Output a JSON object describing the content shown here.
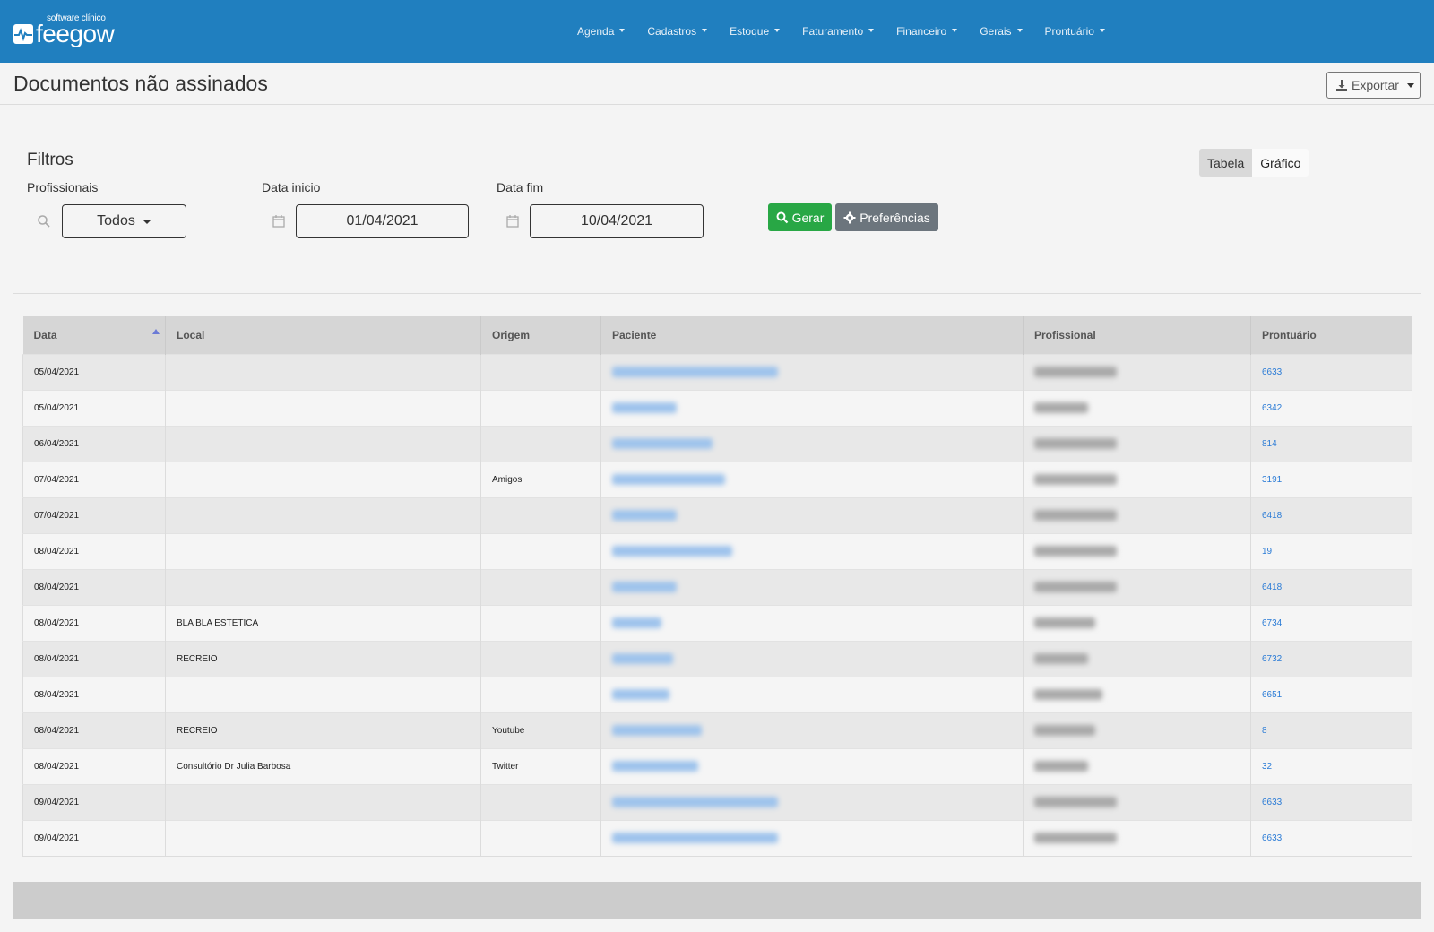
{
  "app": {
    "logo_sub": "software clínico",
    "logo_main": "feegow"
  },
  "nav": [
    {
      "label": "Agenda"
    },
    {
      "label": "Cadastros"
    },
    {
      "label": "Estoque"
    },
    {
      "label": "Faturamento"
    },
    {
      "label": "Financeiro"
    },
    {
      "label": "Gerais"
    },
    {
      "label": "Prontuário"
    }
  ],
  "page": {
    "title": "Documentos não assinados",
    "export_label": "Exportar"
  },
  "filters": {
    "title": "Filtros",
    "profissionais_label": "Profissionais",
    "profissionais_value": "Todos",
    "data_inicio_label": "Data inicio",
    "data_inicio_value": "01/04/2021",
    "data_fim_label": "Data fim",
    "data_fim_value": "10/04/2021",
    "gerar_label": "Gerar",
    "preferencias_label": "Preferências"
  },
  "view_toggle": {
    "tabela": "Tabela",
    "grafico": "Gráfico"
  },
  "table": {
    "columns": [
      "Data",
      "Local",
      "Origem",
      "Paciente",
      "Profissional",
      "Prontuário"
    ],
    "rows": [
      {
        "data": "05/04/2021",
        "local": "",
        "origem": "",
        "prontuario": "6633"
      },
      {
        "data": "05/04/2021",
        "local": "",
        "origem": "",
        "prontuario": "6342"
      },
      {
        "data": "06/04/2021",
        "local": "",
        "origem": "",
        "prontuario": "814"
      },
      {
        "data": "07/04/2021",
        "local": "",
        "origem": "Amigos",
        "prontuario": "3191"
      },
      {
        "data": "07/04/2021",
        "local": "",
        "origem": "",
        "prontuario": "6418"
      },
      {
        "data": "08/04/2021",
        "local": "",
        "origem": "",
        "prontuario": "19"
      },
      {
        "data": "08/04/2021",
        "local": "",
        "origem": "",
        "prontuario": "6418"
      },
      {
        "data": "08/04/2021",
        "local": "BLA BLA ESTETICA",
        "origem": "",
        "prontuario": "6734"
      },
      {
        "data": "08/04/2021",
        "local": "RECREIO",
        "origem": "",
        "prontuario": "6732"
      },
      {
        "data": "08/04/2021",
        "local": "",
        "origem": "",
        "prontuario": "6651"
      },
      {
        "data": "08/04/2021",
        "local": "RECREIO",
        "origem": "Youtube",
        "prontuario": "8"
      },
      {
        "data": "08/04/2021",
        "local": "Consultório Dr Julia Barbosa",
        "origem": "Twitter",
        "prontuario": "32"
      },
      {
        "data": "09/04/2021",
        "local": "",
        "origem": "",
        "prontuario": "6633"
      },
      {
        "data": "09/04/2021",
        "local": "",
        "origem": "",
        "prontuario": "6633"
      }
    ]
  },
  "colors": {
    "topbar": "#207fbf",
    "link": "#2a7bd6",
    "gerar": "#28a745",
    "preferencias": "#6c757d"
  }
}
